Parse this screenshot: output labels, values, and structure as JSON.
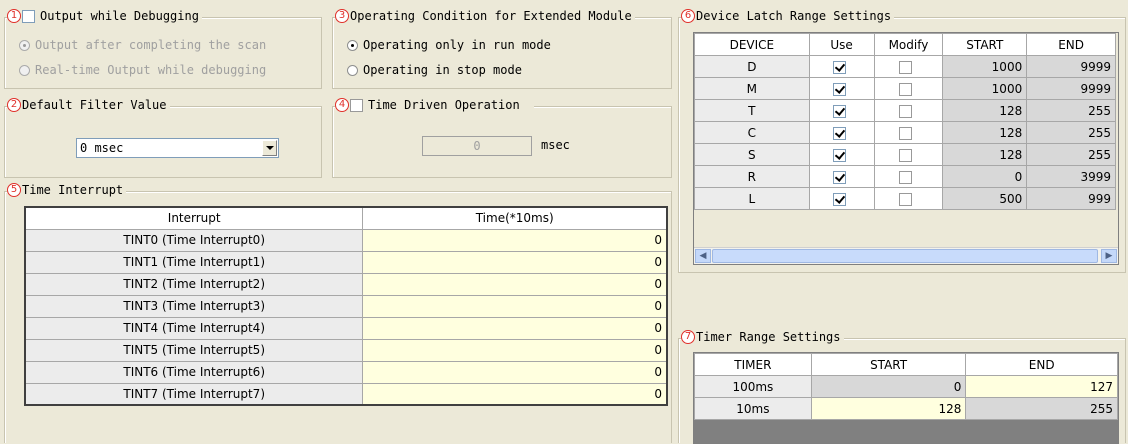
{
  "colors": {
    "marker": "#e0302a",
    "editable_cell": "#ffffdf",
    "readonly_cell": "#d8d8d8",
    "panel": "#ece9d8"
  },
  "output_debug": {
    "number": "1",
    "title": "Output while Debugging",
    "checked": false,
    "options": [
      "Output after completing the scan",
      "Real-time Output while debugging"
    ],
    "selected_index": 0
  },
  "operating_condition": {
    "number": "3",
    "title": "Operating Condition for Extended Module",
    "options": [
      "Operating only in run mode",
      "Operating in stop mode"
    ],
    "selected_index": 0
  },
  "filter": {
    "number": "2",
    "title": "Default Filter Value",
    "value": "0 msec",
    "dropdown_icon": "chevron-down-icon"
  },
  "time_driven": {
    "number": "4",
    "title": "Time Driven Operation",
    "checked": false,
    "value": "0",
    "unit": "msec"
  },
  "time_interrupt": {
    "number": "5",
    "title": "Time Interrupt",
    "headers": [
      "Interrupt",
      "Time(*10ms)"
    ],
    "rows": [
      {
        "name": "TINT0 (Time Interrupt0)",
        "time": "0"
      },
      {
        "name": "TINT1 (Time Interrupt1)",
        "time": "0"
      },
      {
        "name": "TINT2 (Time Interrupt2)",
        "time": "0"
      },
      {
        "name": "TINT3 (Time Interrupt3)",
        "time": "0"
      },
      {
        "name": "TINT4 (Time Interrupt4)",
        "time": "0"
      },
      {
        "name": "TINT5 (Time Interrupt5)",
        "time": "0"
      },
      {
        "name": "TINT6 (Time Interrupt6)",
        "time": "0"
      },
      {
        "name": "TINT7 (Time Interrupt7)",
        "time": "0"
      }
    ]
  },
  "device_latch": {
    "number": "6",
    "title": "Device Latch Range Settings",
    "headers": [
      "DEVICE",
      "Use",
      "Modify",
      "START",
      "END"
    ],
    "rows": [
      {
        "device": "D",
        "use": true,
        "modify": false,
        "start": "1000",
        "end": "9999"
      },
      {
        "device": "M",
        "use": true,
        "modify": false,
        "start": "1000",
        "end": "9999"
      },
      {
        "device": "T",
        "use": true,
        "modify": false,
        "start": "128",
        "end": "255"
      },
      {
        "device": "C",
        "use": true,
        "modify": false,
        "start": "128",
        "end": "255"
      },
      {
        "device": "S",
        "use": true,
        "modify": false,
        "start": "128",
        "end": "255"
      },
      {
        "device": "R",
        "use": true,
        "modify": false,
        "start": "0",
        "end": "3999"
      },
      {
        "device": "L",
        "use": true,
        "modify": false,
        "start": "500",
        "end": "999"
      }
    ],
    "scroll_left_icon": "arrow-left-icon",
    "scroll_right_icon": "arrow-right-icon"
  },
  "timer_range": {
    "number": "7",
    "title": "Timer Range Settings",
    "headers": [
      "TIMER",
      "START",
      "END"
    ],
    "rows": [
      {
        "timer": "100ms",
        "start": "0",
        "end": "127"
      },
      {
        "timer": "10ms",
        "start": "128",
        "end": "255"
      }
    ]
  }
}
